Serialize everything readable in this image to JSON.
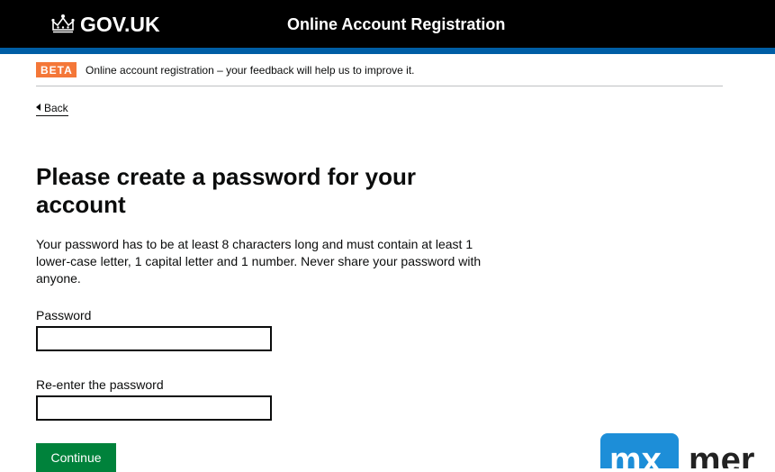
{
  "header": {
    "logo_text": "GOV.UK",
    "logo_icon": "crown-icon",
    "service_name": "Online Account Registration",
    "colors": {
      "background": "#000000",
      "accent_bar": "#005ea5"
    }
  },
  "phase_banner": {
    "tag": "BETA",
    "tag_color": "#f47738",
    "text": "Online account registration – your feedback will help us to improve it."
  },
  "back_link": {
    "label": "Back",
    "icon": "back-arrow-icon"
  },
  "main": {
    "title": "Please create a password for your account",
    "intro": "Your password has to be at least 8 characters long and must contain at least 1 lower-case letter, 1 capital letter and 1 number. Never share your password with anyone.",
    "fields": [
      {
        "label": "Password",
        "value": "",
        "placeholder": ""
      },
      {
        "label": "Re-enter the password",
        "value": "",
        "placeholder": ""
      }
    ],
    "continue_label": "Continue",
    "button_color": "#00823b"
  },
  "watermark": {
    "mark": "mx",
    "name": "mer",
    "mark_color": "#1d8ed8"
  }
}
